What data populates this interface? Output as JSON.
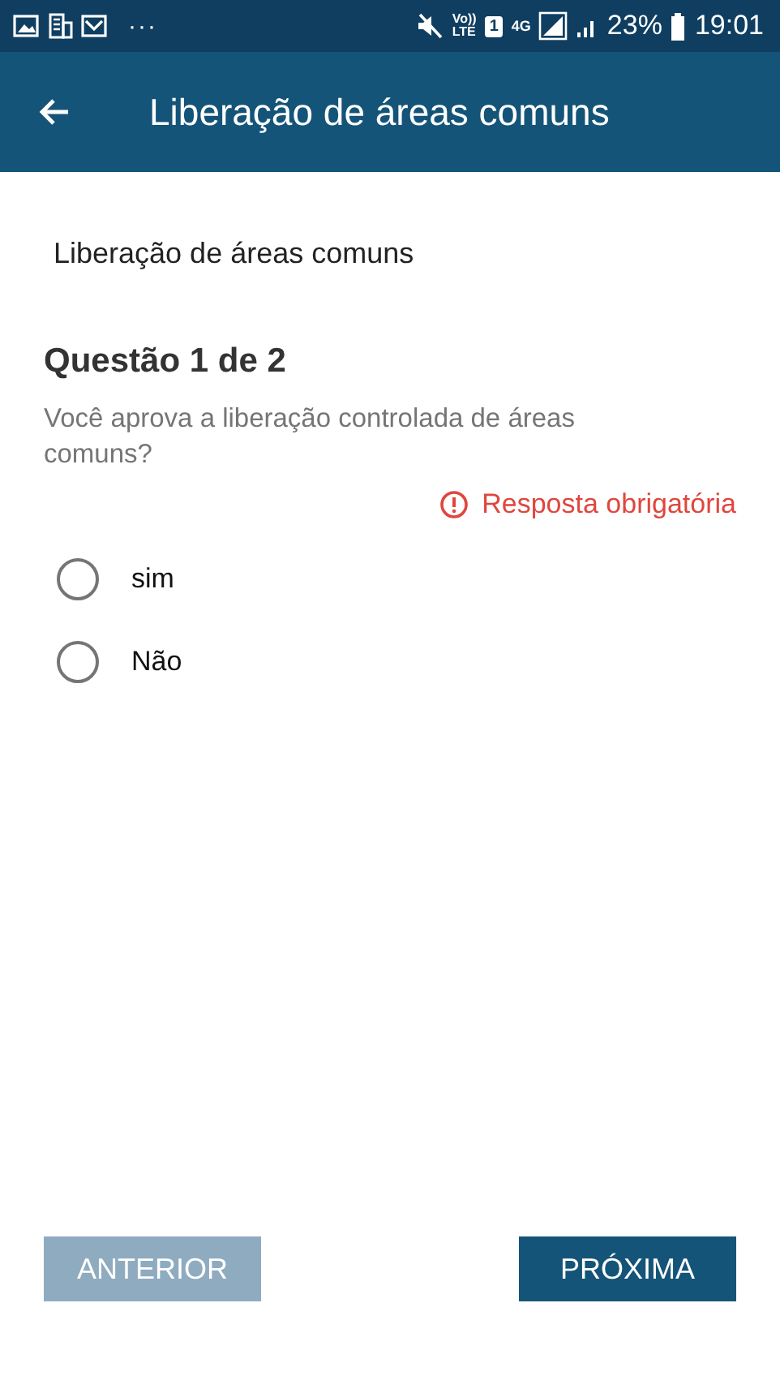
{
  "status_bar": {
    "left_more": "···",
    "volte": [
      "Vo))",
      "LTE"
    ],
    "sim": "1",
    "network": "4G",
    "battery": "23%",
    "time": "19:01"
  },
  "app_bar": {
    "title": "Liberação de áreas comuns"
  },
  "page_title": "Liberação de áreas comuns",
  "question": {
    "heading": "Questão 1 de 2",
    "text": "Você aprova a liberação controlada de áreas comuns?",
    "required": true,
    "required_text": "Resposta obrigatória"
  },
  "options": [
    {
      "label": "sim",
      "selected": false
    },
    {
      "label": "Não",
      "selected": false
    }
  ],
  "buttons": [
    {
      "label": "ANTERIOR",
      "disabled": true
    },
    {
      "label": "PRÓXIMA",
      "disabled": false
    }
  ]
}
